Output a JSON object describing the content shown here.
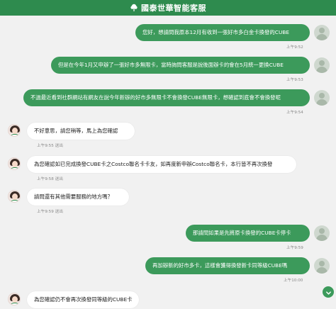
{
  "header": {
    "title": "國泰世華智能客服",
    "logo_icon": "cathay-tree-icon",
    "accent": "#2e8b4e"
  },
  "messages": [
    {
      "sender": "user",
      "text": "您好，想請問我原本12月有收到一張好市多白金卡換發的CUBE",
      "time": "上午9:52"
    },
    {
      "sender": "user",
      "text": "但是在今年1月又申辦了一張好市多無限卡，當時詢問客服是說後面辦卡的會在5月統一更換CUBE",
      "time": "上午9:53"
    },
    {
      "sender": "user",
      "text": "不過最近看到社群網站有網友在說今年新辦的好市多無限卡不會換發CUBE無限卡，想確認到底會不會換發呢",
      "time": "上午9:54"
    },
    {
      "sender": "agent",
      "text": "不好意思，請您稍等，馬上為您確認",
      "time": "上午9:55",
      "read": "送出"
    },
    {
      "sender": "agent",
      "text": "為您確認如已完成換發CUBE卡之Costco聯名卡卡友，如再度新申辦Costco聯名卡，本行皆不再次換發",
      "time": "上午9:58",
      "read": "送出"
    },
    {
      "sender": "agent",
      "text": "請問還有其他需要服務的地方嗎？",
      "time": "上午9:59",
      "read": "送出"
    },
    {
      "sender": "user",
      "text": "那請問如果是先將原卡換發的CUBE卡停卡",
      "time": "上午9:59"
    },
    {
      "sender": "user",
      "text": "再加辦新的好市多卡，這樣會獲得換發新卡同等級CUBE嗎",
      "time": "上午10:00"
    },
    {
      "sender": "agent",
      "text": "為您確認仍不會再次換發同等級的CUBE卡",
      "time": "",
      "read": ""
    }
  ],
  "scroll_button": {
    "icon": "chevron-down-icon"
  },
  "colors": {
    "user_bubble": "#3c9a5b",
    "agent_bubble": "#ffffff",
    "background": "#f1f1f1"
  }
}
